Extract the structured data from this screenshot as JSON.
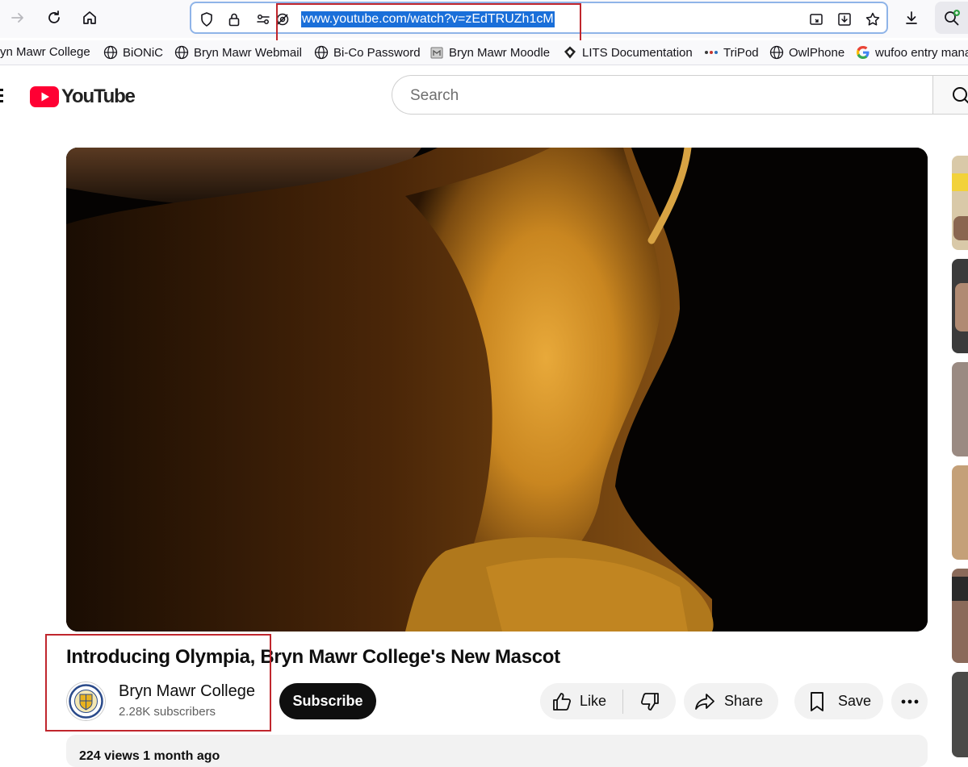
{
  "browser": {
    "url": "www.youtube.com/watch?v=zEdTRUZh1cM",
    "bookmarks": [
      "yn Mawr College",
      "BiONiC",
      "Bryn Mawr Webmail",
      "Bi-Co Password",
      "Bryn Mawr Moodle",
      "LITS Documentation",
      "TriPod",
      "OwlPhone",
      "wufoo entry mana"
    ]
  },
  "youtube": {
    "logo_text": "YouTube",
    "search_placeholder": "Search"
  },
  "video": {
    "title": "Introducing Olympia, Bryn Mawr College's New Mascot",
    "channel_name": "Bryn Mawr College",
    "subscribers": "2.28K subscribers",
    "subscribe_label": "Subscribe",
    "like_label": "Like",
    "share_label": "Share",
    "save_label": "Save",
    "description_preview": "224 views  1 month ago"
  },
  "colors": {
    "brand_red": "#ff0033",
    "annotation_red": "#c0262d",
    "url_selection": "#1a6fd9"
  }
}
